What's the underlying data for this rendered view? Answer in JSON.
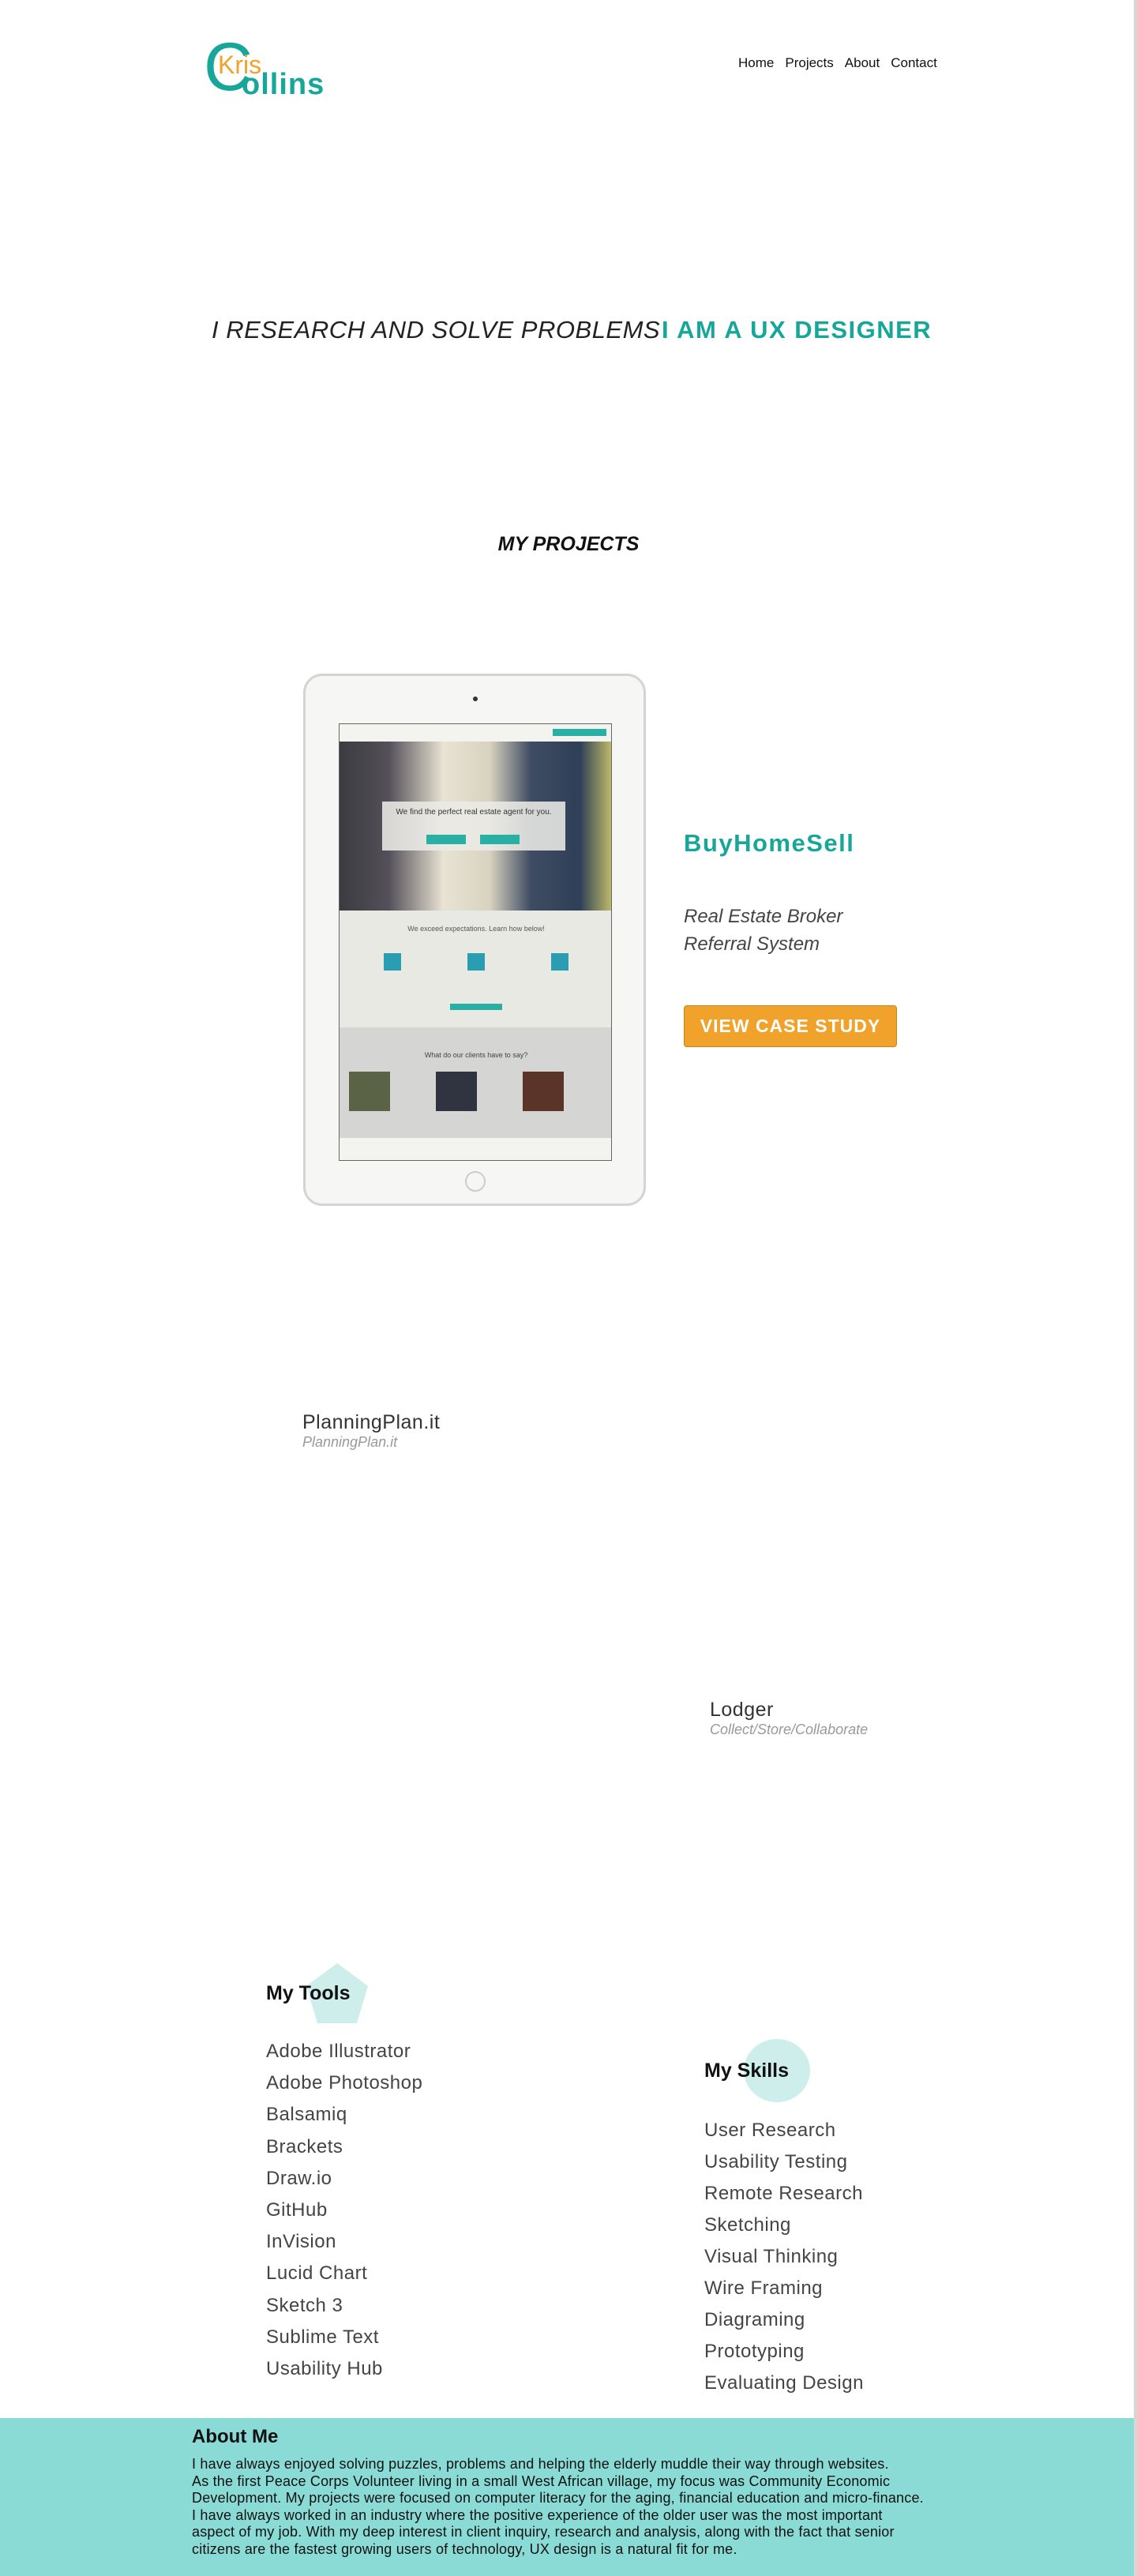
{
  "logo": {
    "c": "C",
    "kris": "Kris",
    "ollins": "ollins"
  },
  "nav": {
    "items": [
      "Home",
      "Projects",
      "About",
      "Contact"
    ]
  },
  "hero": {
    "left": "I RESEARCH AND SOLVE PROBLEMS",
    "right": "I AM A UX DESIGNER"
  },
  "projects": {
    "section_title": "MY PROJECTS",
    "featured": {
      "title": "BuyHomeSell",
      "desc_line1": "Real Estate Broker",
      "desc_line2": "Referral System",
      "button": "VIEW CASE STUDY",
      "screen_headline": "We find the perfect real estate agent for you.",
      "screen_mid": "We exceed expectations. Learn how below!",
      "screen_bottom": "What do our clients have to say?"
    },
    "planningplan": {
      "title": "PlanningPlan.it",
      "subtitle": "PlanningPlan.it"
    },
    "lodger": {
      "title": "Lodger",
      "subtitle": "Collect/Store/Collaborate"
    }
  },
  "tools": {
    "title": "My Tools",
    "items": [
      "Adobe Illustrator",
      "Adobe Photoshop",
      "Balsamiq",
      "Brackets",
      "Draw.io",
      "GitHub",
      "InVision",
      "Lucid Chart",
      "Sketch 3",
      "Sublime Text",
      "Usability Hub"
    ]
  },
  "skills": {
    "title": "My Skills",
    "items": [
      "User Research",
      "Usability Testing",
      "Remote Research",
      "Sketching",
      "Visual Thinking",
      "Wire Framing",
      "Diagraming",
      "Prototyping",
      "Evaluating Design"
    ]
  },
  "about": {
    "title": "About Me",
    "lines": [
      "I have always enjoyed solving puzzles, problems and helping the elderly muddle their way through websites.",
      "As the first Peace Corps Volunteer living in a small West African village,  my focus was Community Economic",
      "Development.  My projects were focused on computer literacy for the aging, financial education and micro-finance.",
      "I have always worked in an industry where the positive experience of the older user was the most important",
      "aspect of my job.  With my deep interest in client inquiry, research and analysis, along with the fact that senior",
      "citizens are the fastest growing users of technology, UX design is a natural fit for me."
    ]
  },
  "colors": {
    "teal": "#16a79a",
    "orange": "#f1a22a",
    "about_bg": "#8adbd5",
    "shape_bg": "#cdeeea"
  }
}
